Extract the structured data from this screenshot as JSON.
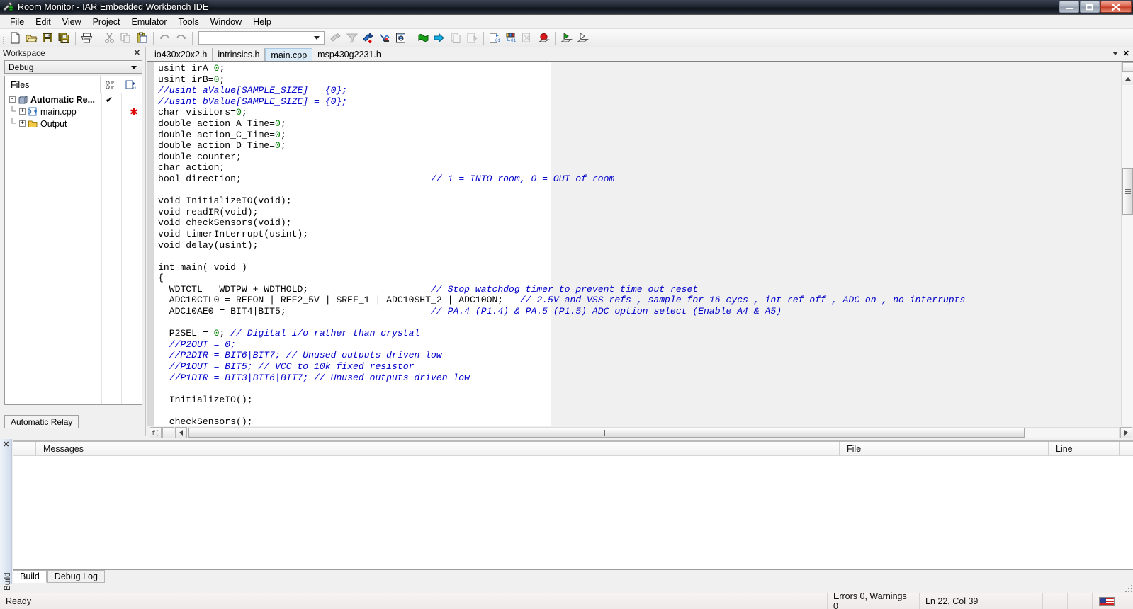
{
  "window": {
    "title": "Room Monitor - IAR Embedded Workbench IDE",
    "app_icon": "iar-workbench-icon",
    "buttons": {
      "minimize": "–",
      "maximize": "❐",
      "close": "✕"
    }
  },
  "menubar": {
    "items": [
      "File",
      "Edit",
      "View",
      "Project",
      "Emulator",
      "Tools",
      "Window",
      "Help"
    ]
  },
  "toolbar": {
    "combo_value": "",
    "groups": [
      {
        "icons": [
          "new-document-icon",
          "open-folder-icon",
          "save-icon",
          "save-all-icon"
        ]
      },
      {
        "icons": [
          "print-icon"
        ]
      },
      {
        "icons": [
          "cut-icon",
          "copy-icon",
          "paste-icon"
        ]
      },
      {
        "icons": [
          "undo-icon",
          "redo-icon"
        ]
      },
      {
        "icons": [
          "find-combo"
        ]
      },
      {
        "icons": [
          "quick-search-icon",
          "find-next-icon",
          "bookmark-toggle-icon",
          "bookmark-clear-icon",
          "find-in-files-icon"
        ]
      },
      {
        "icons": [
          "compile-icon",
          "make-icon",
          "stop-build-icon",
          "debug-without-download-icon"
        ]
      },
      {
        "icons": [
          "next-statement-icon",
          "inspect-icon",
          "disconnect-icon",
          "breakpoint-icon"
        ]
      },
      {
        "icons": [
          "download-and-debug-icon",
          "debug-icon"
        ]
      }
    ]
  },
  "workspace": {
    "panel_title": "Workspace",
    "close_label": "✕",
    "config": "Debug",
    "tree_header": {
      "files": "Files",
      "col_connect": "connections-icon",
      "col_build": "build-status-icon"
    },
    "tree": [
      {
        "label": "Automatic Re...",
        "icon": "project-icon",
        "expander": "-",
        "check": "✔",
        "star": "",
        "indent": 0,
        "bold": true
      },
      {
        "label": "main.cpp",
        "icon": "cpp-file-icon",
        "expander": "+",
        "check": "",
        "star": "✱",
        "indent": 1,
        "bold": false
      },
      {
        "label": "Output",
        "icon": "folder-icon",
        "expander": "+",
        "check": "",
        "star": "",
        "indent": 1,
        "bold": false
      }
    ],
    "bottom_tab": "Automatic Relay"
  },
  "editor": {
    "tabs": [
      {
        "label": "io430x20x2.h",
        "active": false
      },
      {
        "label": "intrinsics.h",
        "active": false
      },
      {
        "label": "main.cpp",
        "active": true
      },
      {
        "label": "msp430g2231.h",
        "active": false
      }
    ],
    "tabbar_controls": {
      "dropdown": "chevron-down-icon",
      "close": "✕"
    },
    "code_lines": [
      {
        "t": "usint irA=",
        "n": "0",
        "t2": ";"
      },
      {
        "t": "usint irB=",
        "n": "0",
        "t2": ";"
      },
      {
        "c": "//usint aValue[SAMPLE_SIZE] = {0};"
      },
      {
        "c": "//usint bValue[SAMPLE_SIZE] = {0};"
      },
      {
        "t": "char visitors=",
        "n": "0",
        "t2": ";"
      },
      {
        "t": "double action_A_Time=",
        "n": "0",
        "t2": ";"
      },
      {
        "t": "double action_C_Time=",
        "n": "0",
        "t2": ";"
      },
      {
        "t": "double action_D_Time=",
        "n": "0",
        "t2": ";"
      },
      {
        "t": "double counter;"
      },
      {
        "t": "char action;"
      },
      {
        "t": "bool direction;",
        "pad": 45,
        "c2": "// 1 = INTO room, 0 = OUT of room"
      },
      {
        "t": ""
      },
      {
        "t": "void InitializeIO(void);"
      },
      {
        "t": "void readIR(void);"
      },
      {
        "t": "void checkSensors(void);"
      },
      {
        "t": "void timerInterrupt(usint);"
      },
      {
        "t": "void delay(usint);"
      },
      {
        "t": ""
      },
      {
        "t": "int main( void )"
      },
      {
        "t": "{"
      },
      {
        "t": "  WDTCTL = WDTPW + WDTHOLD;",
        "pad": 45,
        "c2": "// Stop watchdog timer to prevent time out reset"
      },
      {
        "t": "  ADC10CTL0 = REFON | REF2_5V | SREF_1 | ADC10SHT_2 | ADC10ON;",
        "pad": 45,
        "c2": "// 2.5V and VSS refs , sample for 16 cycs , int ref off , ADC on , no interrupts"
      },
      {
        "t": "  ADC10AE0 = BIT4|BIT5;",
        "pad": 45,
        "c2": "// PA.4 (P1.4) & PA.5 (P1.5) ADC option select (Enable A4 & A5)"
      },
      {
        "t": ""
      },
      {
        "t": "  P2SEL = ",
        "n": "0",
        "t2": "; ",
        "c2inline": "// Digital i/o rather than crystal"
      },
      {
        "c": "  //P2OUT = 0;"
      },
      {
        "c": "  //P2DIR = BIT6|BIT7; // Unused outputs driven low"
      },
      {
        "c": "  //P1OUT = BIT5; // VCC to 10k fixed resistor"
      },
      {
        "c": "  //P1DIR = BIT3|BIT6|BIT7; // Unused outputs driven low"
      },
      {
        "t": ""
      },
      {
        "t": "  InitializeIO();"
      },
      {
        "t": ""
      },
      {
        "t": "  checkSensors();"
      }
    ],
    "status_icons": {
      "fn": "f0-icon",
      "box": "empty-box-icon"
    }
  },
  "build_panel": {
    "close_label": "✕",
    "vertical_label": "Build",
    "columns": [
      "",
      "Messages",
      "File",
      "Line"
    ],
    "rows": [],
    "tabs": [
      {
        "label": "Build",
        "active": true
      },
      {
        "label": "Debug Log",
        "active": false
      }
    ]
  },
  "statusbar": {
    "ready": "Ready",
    "errors": "Errors 0, Warnings 0",
    "position": "Ln 22, Col 39",
    "cells": [
      "",
      "",
      ""
    ],
    "flag": "us-flag-icon"
  }
}
